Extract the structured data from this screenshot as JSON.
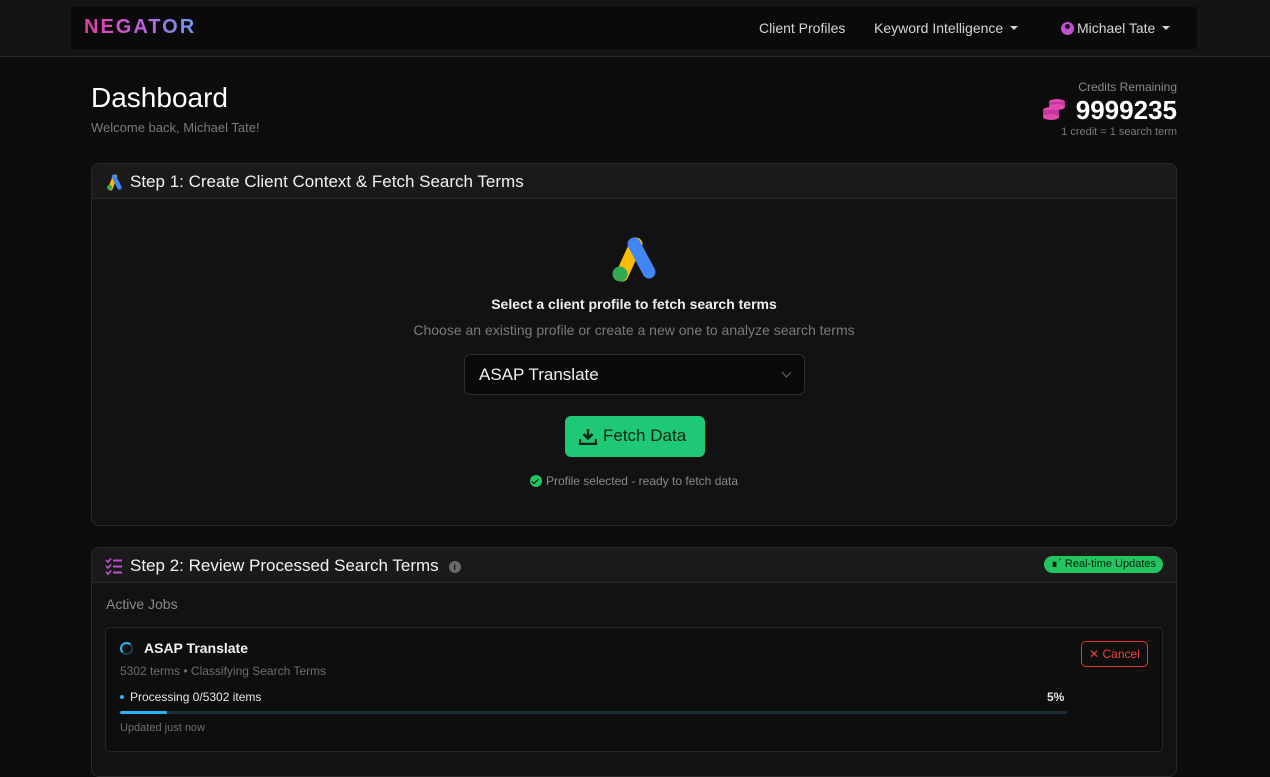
{
  "nav": {
    "logo": "NEGATOR",
    "client_profiles": "Client Profiles",
    "keyword_intelligence": "Keyword Intelligence",
    "user_name": "Michael Tate"
  },
  "header": {
    "title": "Dashboard",
    "welcome": "Welcome back, Michael Tate!",
    "credits_label": "Credits Remaining",
    "credits_value": "9999235",
    "credits_note": "1 credit = 1 search term"
  },
  "step1": {
    "title": "Step 1: Create Client Context & Fetch Search Terms",
    "heading": "Select a client profile to fetch search terms",
    "subheading": "Choose an existing profile or create a new one to analyze search terms",
    "selected_profile": "ASAP Translate",
    "fetch_label": "Fetch Data",
    "status": "Profile selected - ready to fetch data"
  },
  "step2": {
    "title": "Step 2: Review Processed Search Terms",
    "badge": "Real-time Updates",
    "active_jobs_label": "Active Jobs",
    "job": {
      "title": "ASAP Translate",
      "meta": "5302 terms • Classifying Search Terms",
      "cancel_label": "Cancel",
      "processing": "Processing 0/5302 items",
      "percent_label": "5%",
      "progress_fraction": 0.05,
      "updated": "Updated just now"
    }
  },
  "colors": {
    "accent_green": "#1ec874",
    "progress_blue": "#29b6f6",
    "cancel_red": "#ef4444",
    "brand_pink": "#e040a0"
  }
}
